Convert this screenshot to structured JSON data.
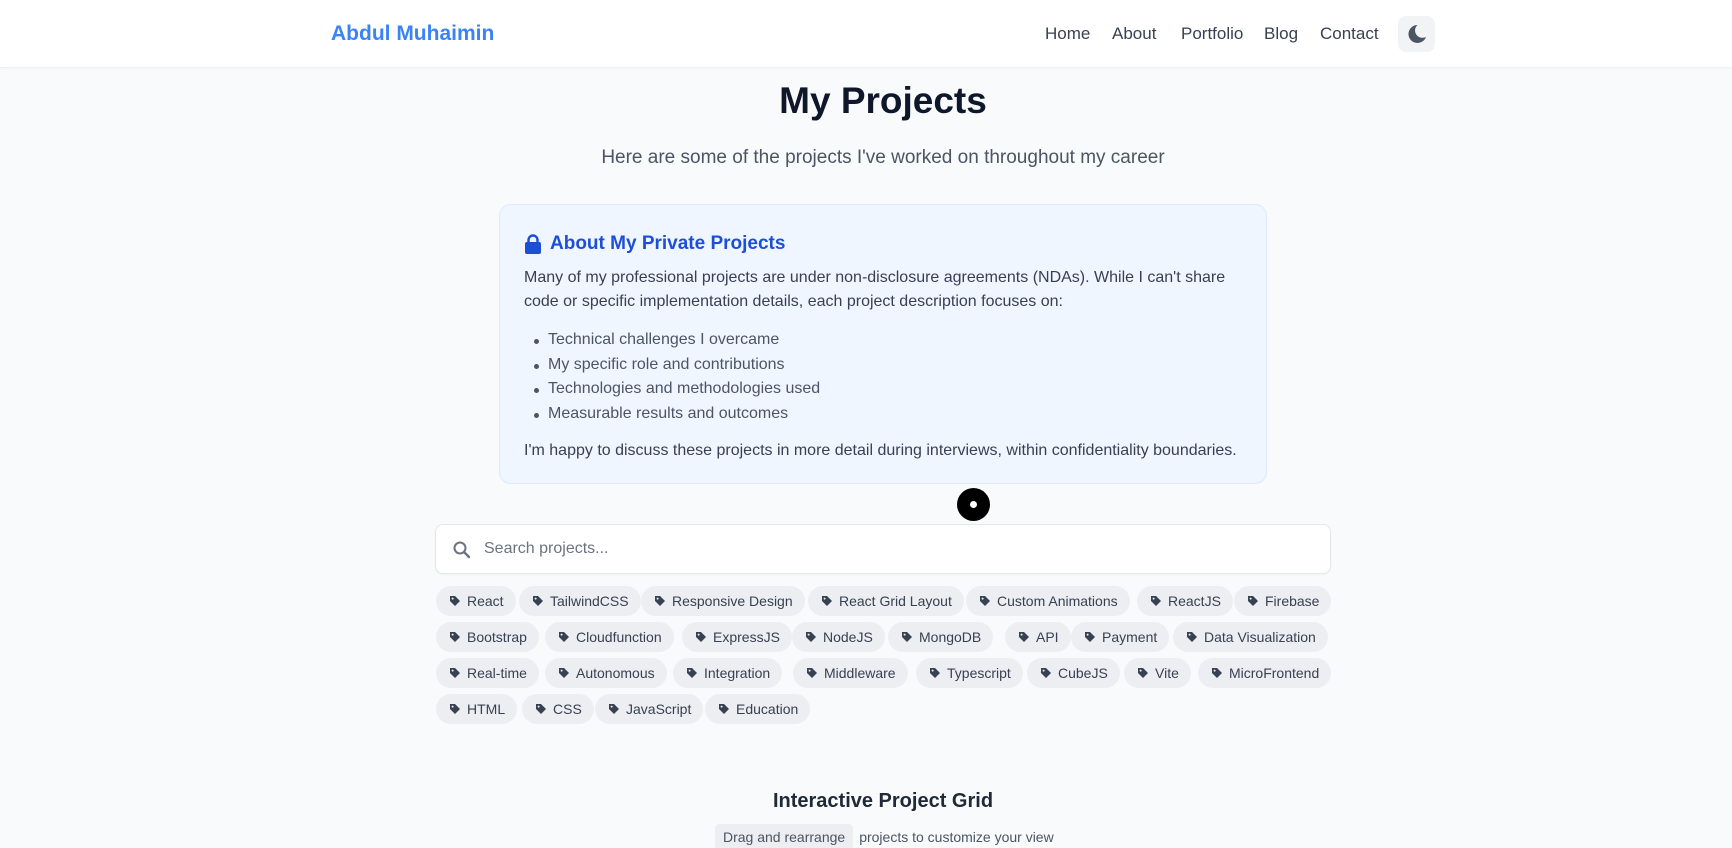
{
  "header": {
    "brand": "Abdul Muhaimin",
    "nav": [
      "Home",
      "About",
      "Portfolio",
      "Blog",
      "Contact"
    ],
    "theme_toggle_icon": "moon-icon"
  },
  "hero": {
    "title": "My Projects",
    "subtitle": "Here are some of the projects I've worked on throughout my career"
  },
  "info": {
    "title": "About My Private Projects",
    "title_icon": "lock-icon",
    "intro": "Many of my professional projects are under non-disclosure agreements (NDAs). While I can't share code or specific implementation details, each project description focuses on:",
    "points": [
      "Technical challenges I overcame",
      "My specific role and contributions",
      "Technologies and methodologies used",
      "Measurable results and outcomes"
    ],
    "outro": "I'm happy to discuss these projects in more detail during interviews, within confidentiality boundaries."
  },
  "search": {
    "placeholder": "Search projects...",
    "value": ""
  },
  "tags": [
    "React",
    "TailwindCSS",
    "Responsive Design",
    "React Grid Layout",
    "Custom Animations",
    "ReactJS",
    "Firebase",
    "Bootstrap",
    "Cloudfunction",
    "ExpressJS",
    "NodeJS",
    "MongoDB",
    "API",
    "Payment",
    "Data Visualization",
    "Real-time",
    "Autonomous",
    "Integration",
    "Middleware",
    "Typescript",
    "CubeJS",
    "Vite",
    "MicroFrontend",
    "HTML",
    "CSS",
    "JavaScript",
    "Education"
  ],
  "grid": {
    "heading": "Interactive Project Grid",
    "chip": "Drag and rearrange",
    "rest": "projects to customize your view"
  },
  "colors": {
    "brand": "#3b82f6",
    "info_title": "#1d4ed8",
    "info_bg": "#eff6ff",
    "page_bg": "#f8fafc",
    "tag_bg": "#eceef2"
  }
}
